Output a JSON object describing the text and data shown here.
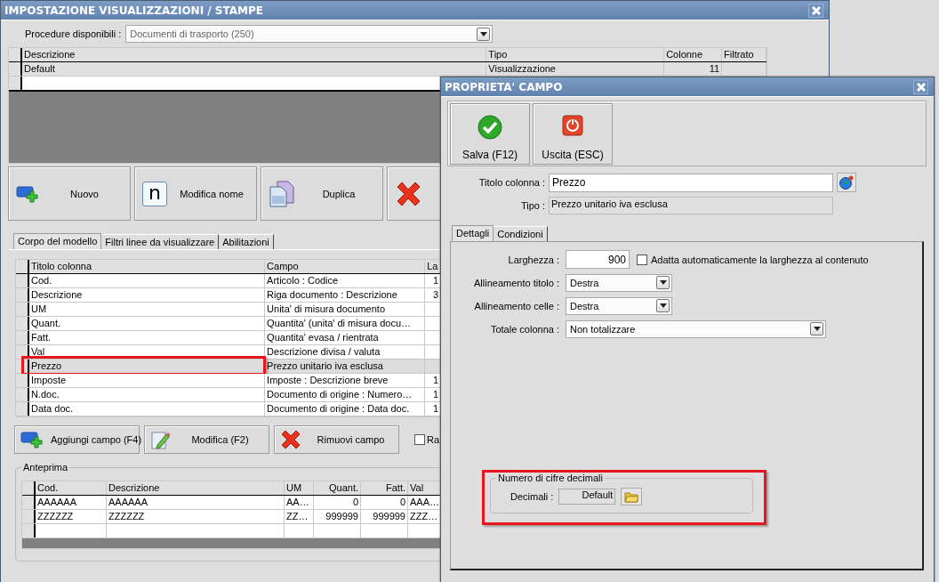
{
  "main_window": {
    "title": "IMPOSTAZIONE VISUALIZZAZIONI / STAMPE",
    "procedure": {
      "label": "Procedure disponibili :",
      "value": "Documenti di trasporto (250)"
    },
    "models_table": {
      "columns": [
        "Descrizione",
        "Tipo",
        "Colonne",
        "Filtrato"
      ],
      "rows": [
        {
          "cells": [
            "Default",
            "Visualizzazione",
            "11"
          ]
        }
      ]
    },
    "toolbar": [
      {
        "kind": "add",
        "label": "Nuovo"
      },
      {
        "kind": "rename",
        "label": "Modifica nome",
        "icon_text": "n"
      },
      {
        "kind": "duplicate",
        "label": "Duplica"
      },
      {
        "kind": "delete"
      }
    ],
    "tabs": [
      {
        "label": "Corpo del modello",
        "selected": true
      },
      {
        "label": "Filtri linee da visualizzare",
        "selected": false
      },
      {
        "label": "Abilitazioni",
        "selected": false
      }
    ],
    "fields_table": {
      "columns": [
        "Titolo colonna",
        "Campo",
        "La"
      ],
      "rows": [
        {
          "cells": [
            "Cod.",
            "Articolo : Codice",
            "1"
          ],
          "selected": false,
          "highlighted": false
        },
        {
          "cells": [
            "Descrizione",
            "Riga documento : Descrizione",
            "3"
          ],
          "selected": false,
          "highlighted": false
        },
        {
          "cells": [
            "UM",
            "Unita' di misura documento"
          ],
          "selected": false,
          "highlighted": false
        },
        {
          "cells": [
            "Quant.",
            "Quantita' (unita' di misura docu…"
          ],
          "selected": false,
          "highlighted": false
        },
        {
          "cells": [
            "Fatt.",
            "Quantita' evasa / rientrata"
          ],
          "selected": false,
          "highlighted": false
        },
        {
          "cells": [
            "Val",
            "Descrizione divisa / valuta"
          ],
          "selected": false,
          "highlighted": false
        },
        {
          "cells": [
            "Prezzo",
            "Prezzo unitario iva esclusa"
          ],
          "selected": true,
          "highlighted": true
        },
        {
          "cells": [
            "Imposte",
            "Imposte : Descrizione breve",
            "1"
          ],
          "selected": false,
          "highlighted": false
        },
        {
          "cells": [
            "N.doc.",
            "Documento di origine : Numero…",
            "1"
          ],
          "selected": false,
          "highlighted": false
        },
        {
          "cells": [
            "Data doc.",
            "Documento di origine : Data doc.",
            "1"
          ],
          "selected": false,
          "highlighted": false
        }
      ]
    },
    "field_buttons": [
      {
        "kind": "add",
        "label": "Aggiungi campo (F4)"
      },
      {
        "kind": "edit",
        "label": "Modifica (F2)"
      },
      {
        "kind": "remove",
        "label": "Rimuovi campo"
      }
    ],
    "option_checkbox": {
      "label": "Ra",
      "checked": false
    },
    "preview": {
      "title": "Anteprima",
      "columns": [
        "Cod.",
        "Descrizione",
        "UM",
        "Quant.",
        "Fatt.",
        "Val"
      ],
      "rows": [
        [
          "AAAAAA",
          "AAAAAA",
          "AA…",
          "0",
          "0",
          "AAA…"
        ],
        [
          "ZZZZZZ",
          "ZZZZZZ",
          "ZZ…",
          "999999",
          "999999",
          "ZZZ…"
        ]
      ]
    }
  },
  "dialog": {
    "title": "PROPRIETA' CAMPO",
    "toolbar": [
      {
        "kind": "save",
        "label": "Salva (F12)"
      },
      {
        "kind": "exit",
        "label": "Uscita (ESC)"
      }
    ],
    "titolo": {
      "label": "Titolo colonna :",
      "value": "Prezzo"
    },
    "tipo": {
      "label": "Tipo :",
      "value": "Prezzo unitario iva esclusa"
    },
    "tabs": [
      {
        "label": "Dettagli",
        "selected": true
      },
      {
        "label": "Condizioni",
        "selected": false
      }
    ],
    "larghezza": {
      "label": "Larghezza :",
      "value": "900"
    },
    "auto_fit": {
      "label": "Adatta automaticamente la larghezza al contenuto",
      "checked": false
    },
    "selects": [
      {
        "label": "Allineamento titolo :",
        "value": "Destra",
        "wide": false
      },
      {
        "label": "Allineamento celle :",
        "value": "Destra",
        "wide": false
      },
      {
        "label": "Totale colonna :",
        "value": "Non totalizzare",
        "wide": true
      }
    ],
    "decimals": {
      "title": "Numero di cifre decimali",
      "label": "Decimali :",
      "value": "Default",
      "highlighted": true
    }
  }
}
